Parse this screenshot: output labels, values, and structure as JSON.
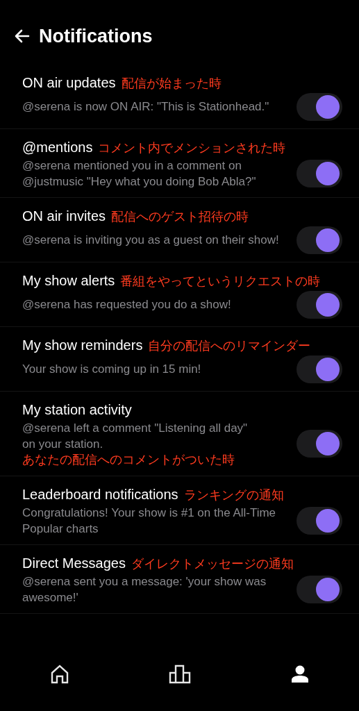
{
  "header": {
    "title": "Notifications"
  },
  "settings": [
    {
      "title": "ON air updates",
      "description": "@serena is now ON AIR: \"This is Stationhead.\"",
      "on": true,
      "note": "配信が始まった時",
      "kind": "heading"
    },
    {
      "title": "@mentions",
      "description": "@serena mentioned you in a comment on  @justmusic \"Hey what you doing Bob Abla?\"",
      "on": true,
      "note": "コメント内でメンションされた時",
      "kind": "heading"
    },
    {
      "title": "ON air invites",
      "description": "@serena is inviting you as a guest on their show!",
      "on": true,
      "note": "配信へのゲスト招待の時",
      "kind": "heading"
    },
    {
      "title": "My show alerts",
      "description": "@serena has requested you do a show!",
      "on": true,
      "note": "番組をやってというリクエストの時",
      "kind": "heading"
    },
    {
      "title": "My show reminders",
      "description": "Your show is coming up in 15 min!",
      "on": true,
      "note": "自分の配信へのリマインダー",
      "kind": "heading"
    },
    {
      "title": "My station activity",
      "description": "@serena left a comment \"Listening all day\" on your station.",
      "on": true,
      "note": "あなたの配信へのコメントがついた時",
      "kind": "inline"
    },
    {
      "title": "Leaderboard notifications",
      "description": "Congratulations! Your show is #1 on the All-Time Popular charts",
      "on": true,
      "note": "ランキングの通知",
      "kind": "heading"
    },
    {
      "title": "Direct Messages",
      "description": "@serena sent you a message: 'your show was awesome!'",
      "on": true,
      "note": "ダイレクトメッセージの通知",
      "kind": "heading"
    }
  ],
  "tab_bar": [
    {
      "kind": "home",
      "selected": false
    },
    {
      "kind": "chart",
      "selected": false
    },
    {
      "kind": "profile",
      "selected": true
    }
  ]
}
